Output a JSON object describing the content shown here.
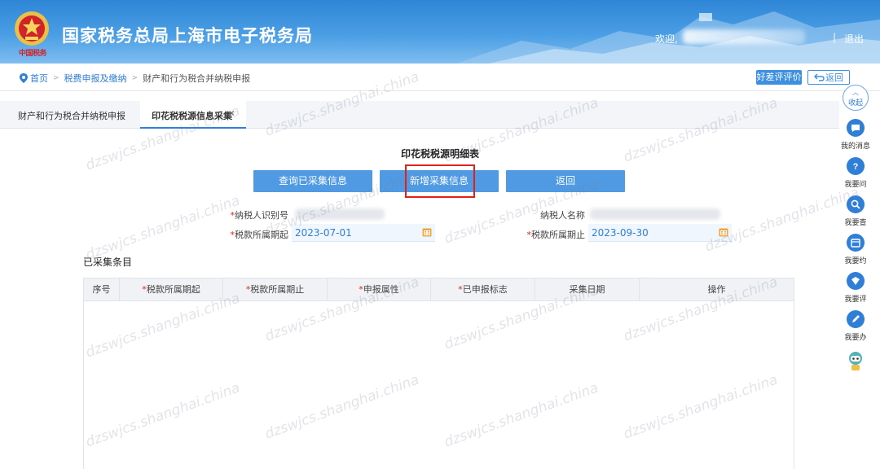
{
  "header": {
    "site_title": "国家税务总局上海市电子税务局",
    "brand_script": "中国税务",
    "welcome": "欢迎,",
    "separator": "|",
    "logout": "退出"
  },
  "breadcrumb": {
    "home": "首页",
    "level2": "税费申报及缴纳",
    "level3": "财产和行为税合并纳税申报",
    "separator": ">"
  },
  "top_actions": {
    "rate": "好差评评价",
    "back": "返回"
  },
  "tabs": [
    {
      "label": "财产和行为税合并纳税申报",
      "active": false
    },
    {
      "label": "印花税税源信息采集",
      "active": true,
      "close": "×"
    }
  ],
  "main": {
    "heading": "印花税税源明细表",
    "buttons": {
      "query": "查询已采集信息",
      "add_new": "新增采集信息",
      "return": "返回"
    },
    "form": {
      "required_mark": "*",
      "tax_id_label": "纳税人识别号",
      "tax_name_label": "纳税人名称",
      "period_start_label": "税款所属期起",
      "period_start_value": "2023-07-01",
      "period_end_label": "税款所属期止",
      "period_end_value": "2023-09-30"
    },
    "section_title": "已采集条目",
    "table": {
      "columns": [
        {
          "label": "序号",
          "required": false
        },
        {
          "label": "税款所属期起",
          "required": true
        },
        {
          "label": "税款所属期止",
          "required": true
        },
        {
          "label": "申报属性",
          "required": true
        },
        {
          "label": "已申报标志",
          "required": true
        },
        {
          "label": "采集日期",
          "required": false
        },
        {
          "label": "操作",
          "required": false
        }
      ]
    }
  },
  "side_bar": {
    "collapse": "收起",
    "items": [
      {
        "label": "我的消息",
        "icon": "chat-icon"
      },
      {
        "label": "我要问",
        "icon": "question-icon"
      },
      {
        "label": "我要查",
        "icon": "search-icon"
      },
      {
        "label": "我要约",
        "icon": "calendar-icon"
      },
      {
        "label": "我要评",
        "icon": "rate-icon"
      },
      {
        "label": "我要办",
        "icon": "pen-icon"
      }
    ]
  },
  "watermark": "dzswjcs.shanghai.china",
  "colors": {
    "header_blue": "#2f86d6",
    "button_blue": "#4f9ae3",
    "highlight_red": "#e0211a",
    "date_text": "#2f7ed8"
  }
}
